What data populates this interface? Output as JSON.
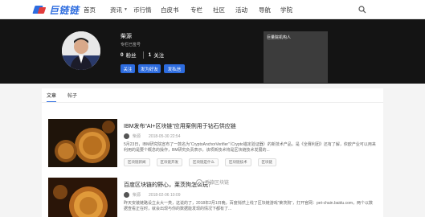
{
  "nav": {
    "logo_text": "巨链链",
    "items": [
      {
        "label": "首页",
        "has_caret": false
      },
      {
        "label": "资讯",
        "has_caret": true
      },
      {
        "label": "币行情",
        "has_caret": false
      },
      {
        "label": "白皮书",
        "has_caret": false
      },
      {
        "label": "专栏",
        "has_caret": false
      },
      {
        "label": "社区",
        "has_caret": false
      },
      {
        "label": "活动",
        "has_caret": false
      },
      {
        "label": "导航",
        "has_caret": false
      },
      {
        "label": "学院",
        "has_caret": false
      }
    ]
  },
  "profile": {
    "name": "柴源",
    "subtitle": "专栏已签号",
    "fans_count": "0",
    "fans_label": "粉丝",
    "follow_count": "1",
    "follow_label": "关注",
    "buttons": {
      "follow": "关注",
      "message": "发为好友",
      "private": "发私信"
    },
    "panel_title": "巨量院机构人"
  },
  "tabs": [
    {
      "label": "文章",
      "active": true
    },
    {
      "label": "帖子",
      "active": false
    }
  ],
  "articles": [
    {
      "title": "IBM发布“AI+区块链”应用案例用于钻石供应链",
      "author": "柴源",
      "date": "2018-05-30 22:54",
      "desc": "5月23日，IBM研究院宣布了一款名为“CryptoAnchorVerifier”（Crypto锚定验证器）的新技术产品，是《全赛利团》还有了解，依欧产业可以用来利用的是要个概念的操作，BM研究负责表示，该项新技术将是区块链技术发展的...",
      "tags": [
        "区块链新闻",
        "区块链开发",
        "区块链是什么",
        "区块链技术",
        "区块链"
      ]
    },
    {
      "title": "百度区块链的野心，莱茨狗怎么玩？",
      "author": "柴源",
      "date": "2018-02-06 10:09",
      "desc": "昨天安装链路设立太大一类，这说的了，2018年2月1日晚，百度悄然上线了区块链游戏“莱茨狗”，打开官网：pet-chain.baidu.com，两个以数据查看正在时，就会出现与你的数据能发现的情况下都有了..."
    }
  ],
  "watermark": "币旅区块链"
}
